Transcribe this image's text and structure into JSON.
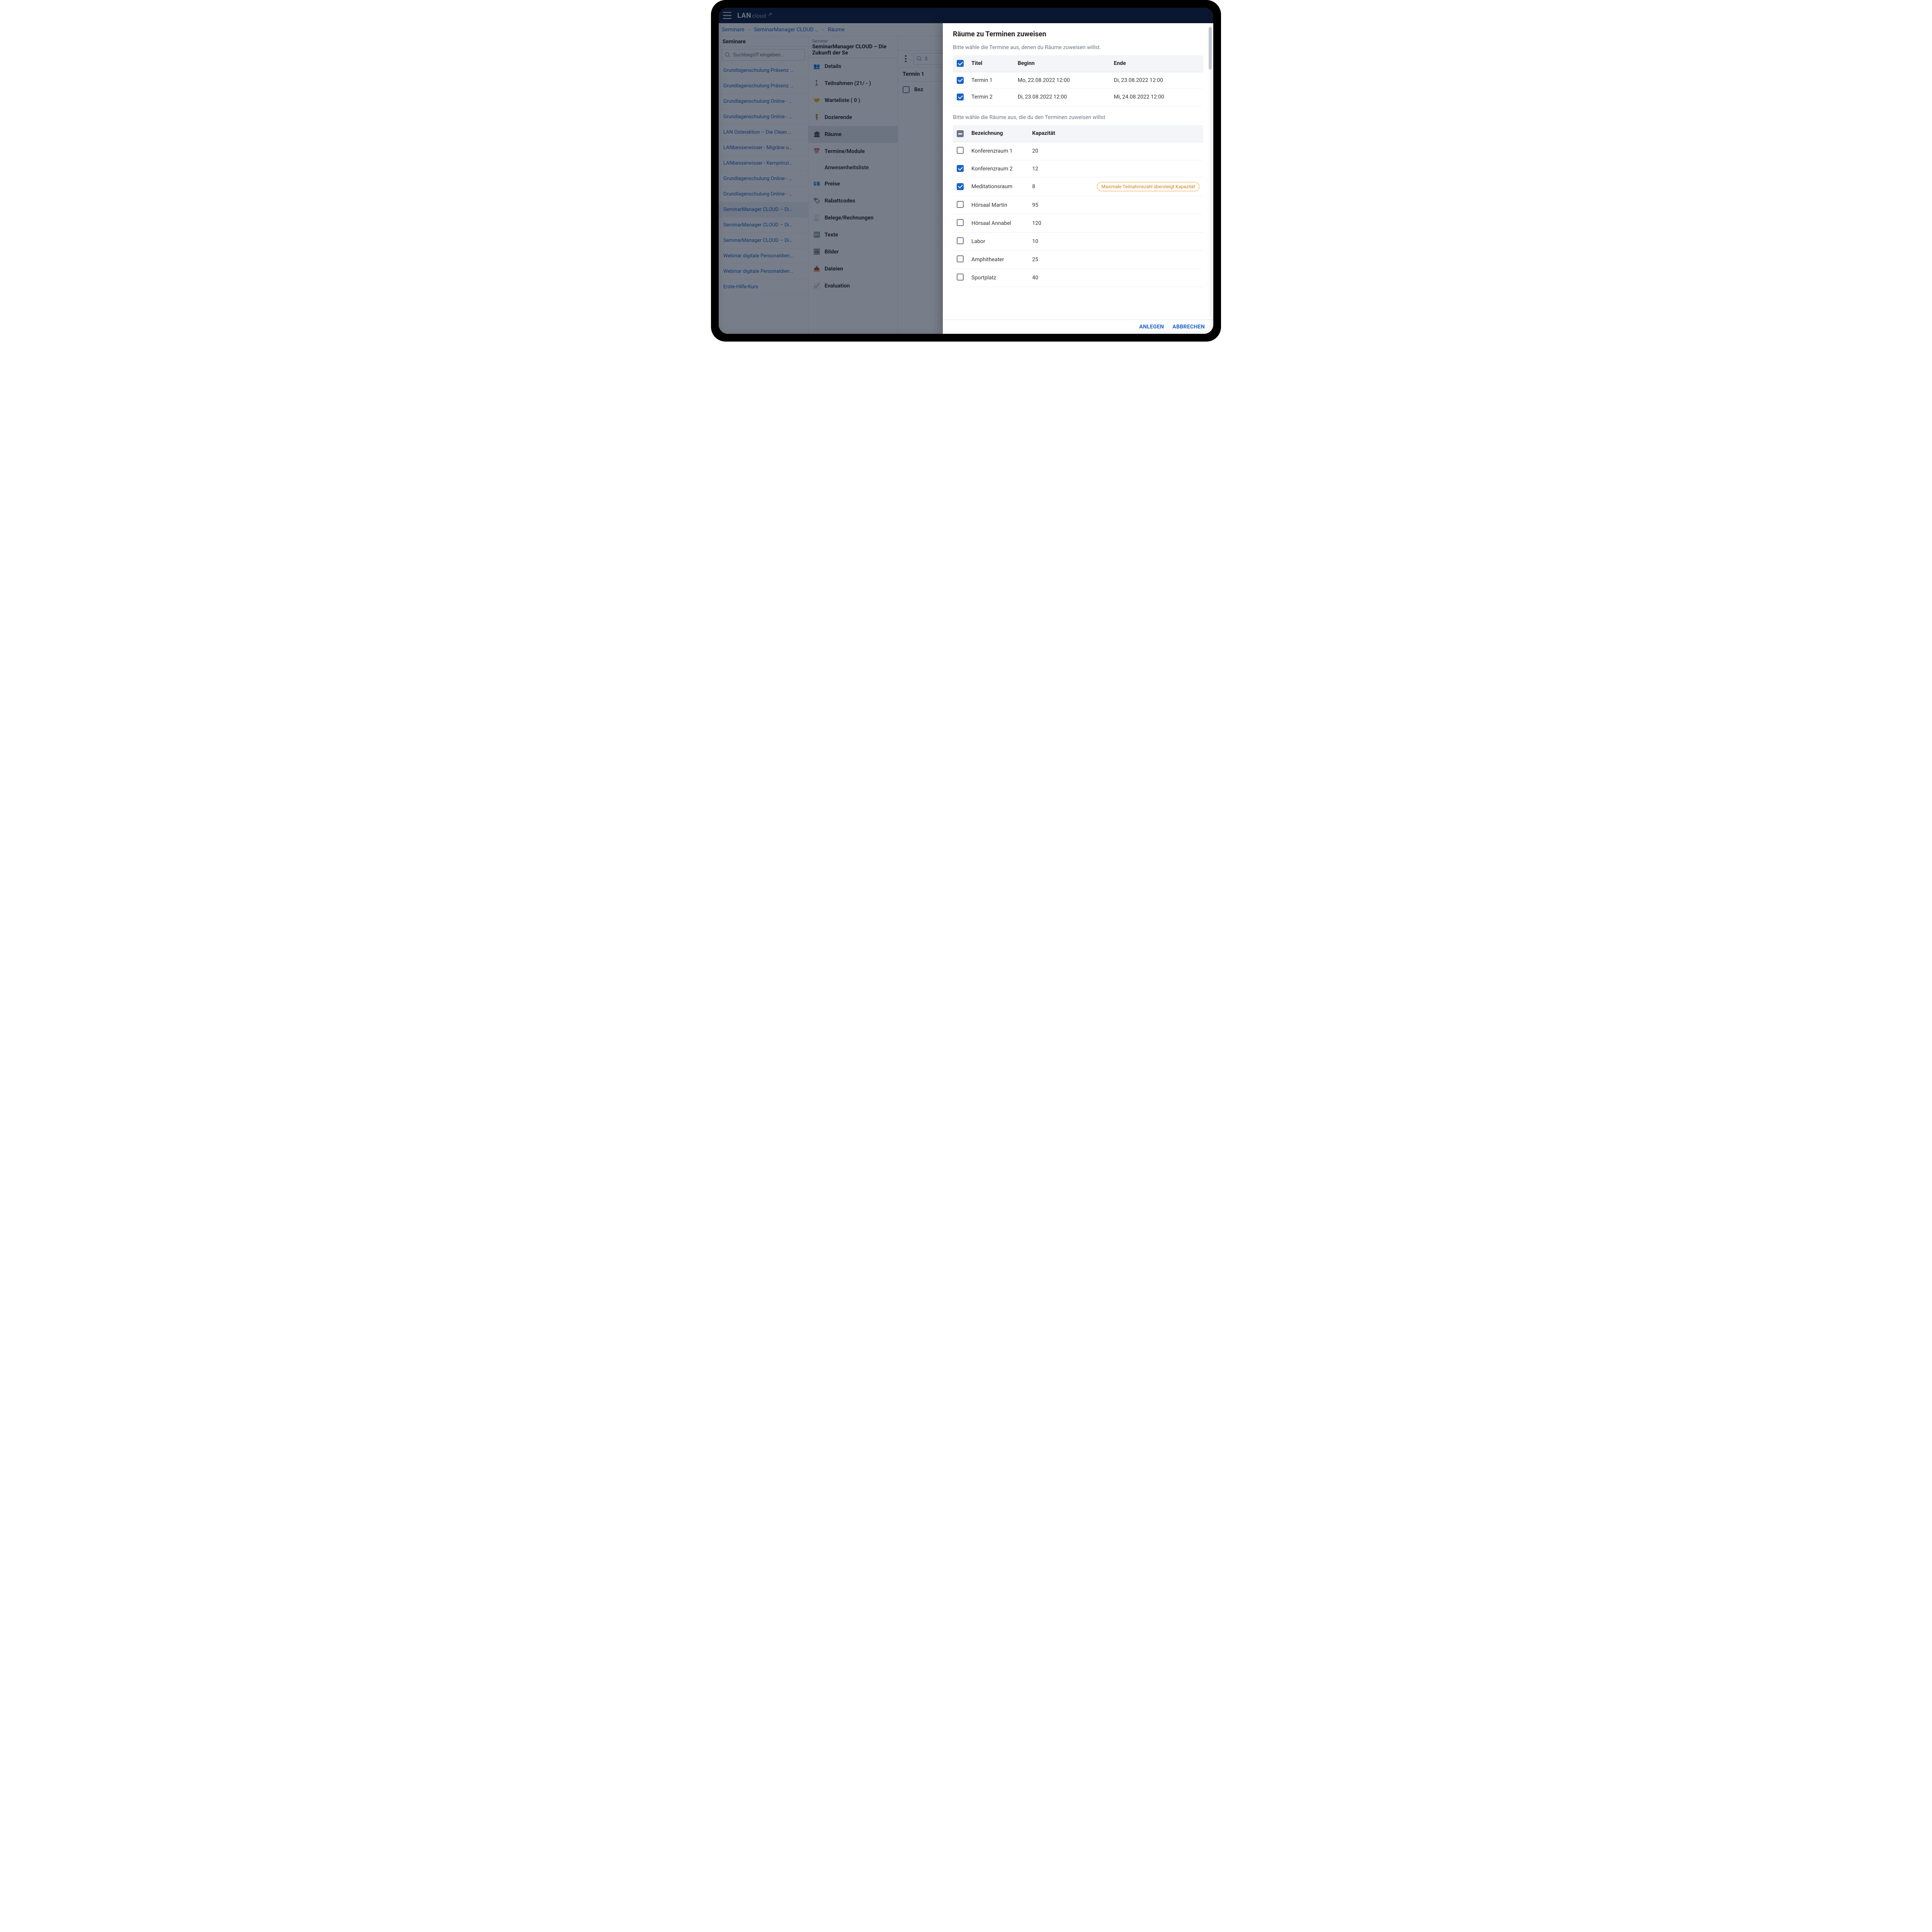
{
  "app": {
    "logo_lan": "LAN",
    "logo_cloud": "cloud"
  },
  "breadcrumb": [
    "Seminare",
    "SeminarManager CLOUD …",
    "Räume"
  ],
  "left": {
    "title": "Seminare",
    "search_placeholder": "Suchbegriff eingeben...",
    "items": [
      "Grundlagenschulung Präsenz …",
      "Grundlagenschulung Präsenz …",
      "Grundlagenschulung Online - …",
      "Grundlagenschulung Online - …",
      "LAN Osteraktion – Die Clean …",
      "LANbesserwisser - Migräne u…",
      "LANbesserwisser - Kernprinzi…",
      "Grundlagenschulung Online - …",
      "Grundlagenschulung Online - …",
      "SeminarManager CLOUD – Di…",
      "SeminarManager CLOUD – Di…",
      "SeminarManager CLOUD – Di…",
      "Webinar digitale Personaldien…",
      "Webinar digitale Personaldien…",
      "Erste-Hilfe-Kurs"
    ],
    "active_index": 9
  },
  "mid": {
    "eyebrow": "Seminar",
    "title": "SeminarManager CLOUD – Die Zukunft der Se",
    "nav": [
      {
        "label": "Details"
      },
      {
        "label": "Teilnahmen (21/ - )"
      },
      {
        "label": "Warteliste ( 0 )"
      },
      {
        "label": "Dozierende"
      },
      {
        "label": "Räume",
        "selected": true
      },
      {
        "label": "Termine/Module"
      },
      {
        "label": "Anwesenheitsliste",
        "sub": true
      },
      {
        "label": "Preise"
      },
      {
        "label": "Rabattcodes"
      },
      {
        "label": "Belege/Rechnungen"
      },
      {
        "label": "Texte"
      },
      {
        "label": "Bilder"
      },
      {
        "label": "Dateien"
      },
      {
        "label": "Evaluation"
      }
    ]
  },
  "content": {
    "search_placeholder": "S",
    "termin_head": "Termin 1",
    "row_label": "Bez"
  },
  "modal": {
    "title": "Räume zu Terminen zuweisen",
    "hint1": "Bitte wähle die Termine aus, denen du Räume zuweisen willst.",
    "hint2": "Bitte wähle die Räume aus, die du den Terminen zuweisen willst",
    "termine_headers": {
      "titel": "Titel",
      "beginn": "Beginn",
      "ende": "Ende"
    },
    "termine": [
      {
        "checked": true,
        "titel": "Termin 1",
        "beginn": "Mo, 22.08.2022 12:00",
        "ende": "Di, 23.08.2022 12:00"
      },
      {
        "checked": true,
        "titel": "Termin 2",
        "beginn": "Di, 23.08.2022 12:00",
        "ende": "Mi, 24.08.2022 12:00"
      }
    ],
    "raum_headers": {
      "bez": "Bezeichnung",
      "kap": "Kapazität"
    },
    "raeume": [
      {
        "checked": false,
        "bez": "Konferenzraum 1",
        "kap": "20"
      },
      {
        "checked": true,
        "bez": "Konferenzraum 2",
        "kap": "12"
      },
      {
        "checked": true,
        "bez": "Meditationsraum",
        "kap": "8",
        "warn": "Maximale Teilnahmezahl übersteigt Kapazität"
      },
      {
        "checked": false,
        "bez": "Hörsaal Martin",
        "kap": "95"
      },
      {
        "checked": false,
        "bez": "Hörsaal Annabel",
        "kap": "120"
      },
      {
        "checked": false,
        "bez": "Labor",
        "kap": "10"
      },
      {
        "checked": false,
        "bez": "Amphitheater",
        "kap": "25"
      },
      {
        "checked": false,
        "bez": "Sportplatz",
        "kap": "40"
      }
    ],
    "actions": {
      "primary": "ANLEGEN",
      "secondary": "ABBRECHEN"
    }
  }
}
